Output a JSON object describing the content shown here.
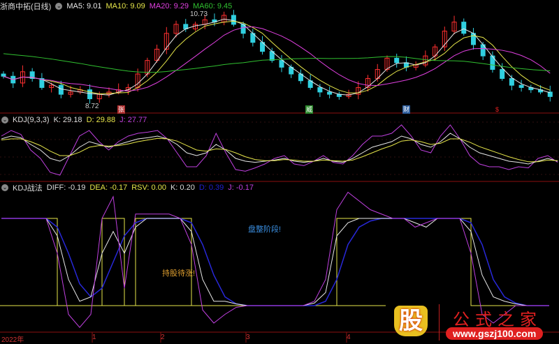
{
  "price_panel": {
    "title": "浙商中拓(日线)",
    "ma": [
      {
        "label": "MA5: 9.01",
        "color": "#e8e8e8"
      },
      {
        "label": "MA10: 9.09",
        "color": "#e6e64a"
      },
      {
        "label": "MA20: 9.29",
        "color": "#e040e0"
      },
      {
        "label": "MA60: 9.45",
        "color": "#30c030"
      }
    ],
    "high_label": "10.73",
    "low_label": "8.72",
    "markers": [
      {
        "text": "张",
        "color": "#b03030"
      },
      {
        "text": "威",
        "color": "#2e8b2e"
      },
      {
        "text": "财",
        "color": "#2f5f9f"
      },
      {
        "text": "$",
        "color": "#e02020"
      }
    ],
    "closes": [
      9.35,
      9.2,
      9.45,
      9.3,
      9.1,
      9.15,
      8.95,
      9.0,
      9.05,
      8.85,
      8.95,
      9.0,
      9.05,
      9.1,
      9.4,
      9.7,
      9.95,
      10.3,
      10.5,
      10.4,
      10.5,
      10.6,
      10.55,
      10.7,
      10.5,
      10.3,
      10.1,
      9.9,
      9.7,
      9.55,
      9.4,
      9.25,
      9.1,
      9.0,
      8.95,
      8.9,
      8.95,
      9.1,
      9.3,
      9.5,
      9.75,
      9.65,
      9.55,
      9.6,
      9.8,
      10.0,
      10.35,
      10.55,
      10.3,
      10.05,
      9.8,
      9.5,
      9.3,
      9.15,
      9.1,
      9.05,
      9.0,
      8.9
    ],
    "ma60_start": 9.85,
    "up_color": "#ff3030",
    "down_color": "#30d0e0"
  },
  "kdj_panel": {
    "title": "KDJ(9,3,3)",
    "k_label": "K: 29.18",
    "d_label": "D: 29.88",
    "j_label": "J: 27.77",
    "k": [
      70,
      75,
      72,
      60,
      50,
      35,
      30,
      40,
      55,
      65,
      60,
      55,
      60,
      65,
      70,
      72,
      75,
      70,
      60,
      45,
      40,
      45,
      60,
      50,
      35,
      30,
      28,
      30,
      32,
      35,
      30,
      28,
      30,
      35,
      30,
      28,
      35,
      45,
      55,
      60,
      65,
      75,
      70,
      60,
      55,
      65,
      80,
      70,
      55,
      45,
      40,
      35,
      30,
      28,
      25,
      30,
      35,
      30
    ],
    "d": [
      68,
      70,
      70,
      65,
      58,
      48,
      40,
      40,
      46,
      55,
      58,
      57,
      58,
      61,
      65,
      68,
      71,
      70,
      66,
      58,
      50,
      48,
      52,
      51,
      45,
      38,
      33,
      31,
      31,
      33,
      32,
      30,
      30,
      32,
      31,
      30,
      32,
      38,
      45,
      52,
      58,
      66,
      68,
      65,
      60,
      62,
      70,
      70,
      64,
      56,
      50,
      44,
      38,
      33,
      29,
      29,
      32,
      31
    ],
    "j": [
      75,
      85,
      78,
      50,
      35,
      10,
      5,
      40,
      75,
      85,
      65,
      50,
      65,
      75,
      80,
      82,
      85,
      70,
      45,
      20,
      20,
      40,
      80,
      45,
      15,
      12,
      18,
      25,
      35,
      40,
      25,
      22,
      30,
      40,
      28,
      25,
      40,
      60,
      75,
      75,
      80,
      95,
      75,
      50,
      45,
      75,
      95,
      70,
      40,
      25,
      20,
      20,
      15,
      20,
      18,
      35,
      40,
      28
    ],
    "colors": {
      "k": "#e8e8e8",
      "d": "#e6e64a",
      "j": "#c040e0"
    }
  },
  "kdj_war_panel": {
    "title": "KDJ战法",
    "labels": [
      {
        "text": "DIFF: -0.19",
        "color": "#dddddd"
      },
      {
        "text": "DEA: -0.17",
        "color": "#e6e64a"
      },
      {
        "text": "RSV: 0.00",
        "color": "#e6e64a"
      },
      {
        "text": "K: 0.20",
        "color": "#dddddd"
      },
      {
        "text": "D: 0.39",
        "color": "#2020d0"
      },
      {
        "text": "J: -0.17",
        "color": "#c040e0"
      }
    ],
    "note_consolidate": "盘整阶段!",
    "note_hold": "持股待涨!",
    "rsv": [
      1,
      1,
      1,
      1,
      1,
      0,
      0,
      0,
      0,
      1,
      1,
      0,
      1,
      1,
      1,
      1,
      1,
      0,
      0,
      0,
      0,
      0,
      0,
      0,
      0,
      0,
      0,
      0,
      0,
      0,
      1,
      1,
      1,
      1,
      1,
      1,
      1,
      1,
      1,
      1,
      1,
      1,
      0,
      0,
      0,
      0,
      0,
      0,
      0,
      0
    ],
    "k": [
      1,
      1,
      1,
      1,
      1,
      0.8,
      0.3,
      0.05,
      0.1,
      0.6,
      0.85,
      0.6,
      0.9,
      1,
      1,
      1,
      1,
      0.85,
      0.3,
      0.05,
      0.05,
      0.02,
      0,
      0,
      0,
      0,
      0,
      0,
      0.03,
      0.15,
      0.8,
      0.95,
      1,
      1,
      1,
      1,
      1,
      0.95,
      0.9,
      1,
      1,
      1,
      0.85,
      0.35,
      0.1,
      0.05,
      0.02,
      0,
      0,
      0
    ],
    "d": [
      1,
      1,
      1,
      1,
      1,
      0.9,
      0.6,
      0.25,
      0.1,
      0.2,
      0.5,
      0.8,
      0.95,
      1,
      1,
      1,
      1,
      0.95,
      0.7,
      0.35,
      0.1,
      0.02,
      0,
      0,
      0,
      0,
      0,
      0,
      0,
      0.05,
      0.3,
      0.7,
      0.9,
      0.97,
      1,
      1,
      1,
      1,
      1,
      1,
      1,
      1,
      0.95,
      0.7,
      0.3,
      0.1,
      0.03,
      0,
      0,
      0
    ],
    "j": [
      1,
      1,
      1,
      1,
      1,
      0.6,
      -0.1,
      -0.25,
      -0.1,
      1.0,
      1.25,
      0.2,
      1.05,
      1.05,
      1.05,
      1.05,
      1.0,
      0.7,
      -0.05,
      -0.2,
      -0.1,
      -0.02,
      0,
      0,
      0,
      0,
      0,
      0,
      0.05,
      0.3,
      1.1,
      1.3,
      1.2,
      1.1,
      1.05,
      1.0,
      1.0,
      0.9,
      0.95,
      1.0,
      1.0,
      1.0,
      0.6,
      -0.1,
      -0.2,
      -0.1,
      0,
      0,
      0,
      0
    ]
  },
  "time_axis": [
    "2022年",
    "1",
    "2",
    "3",
    "4"
  ],
  "watermark": {
    "icon_text": "股",
    "name": "公式之家",
    "url": "www.gszj100.com"
  }
}
